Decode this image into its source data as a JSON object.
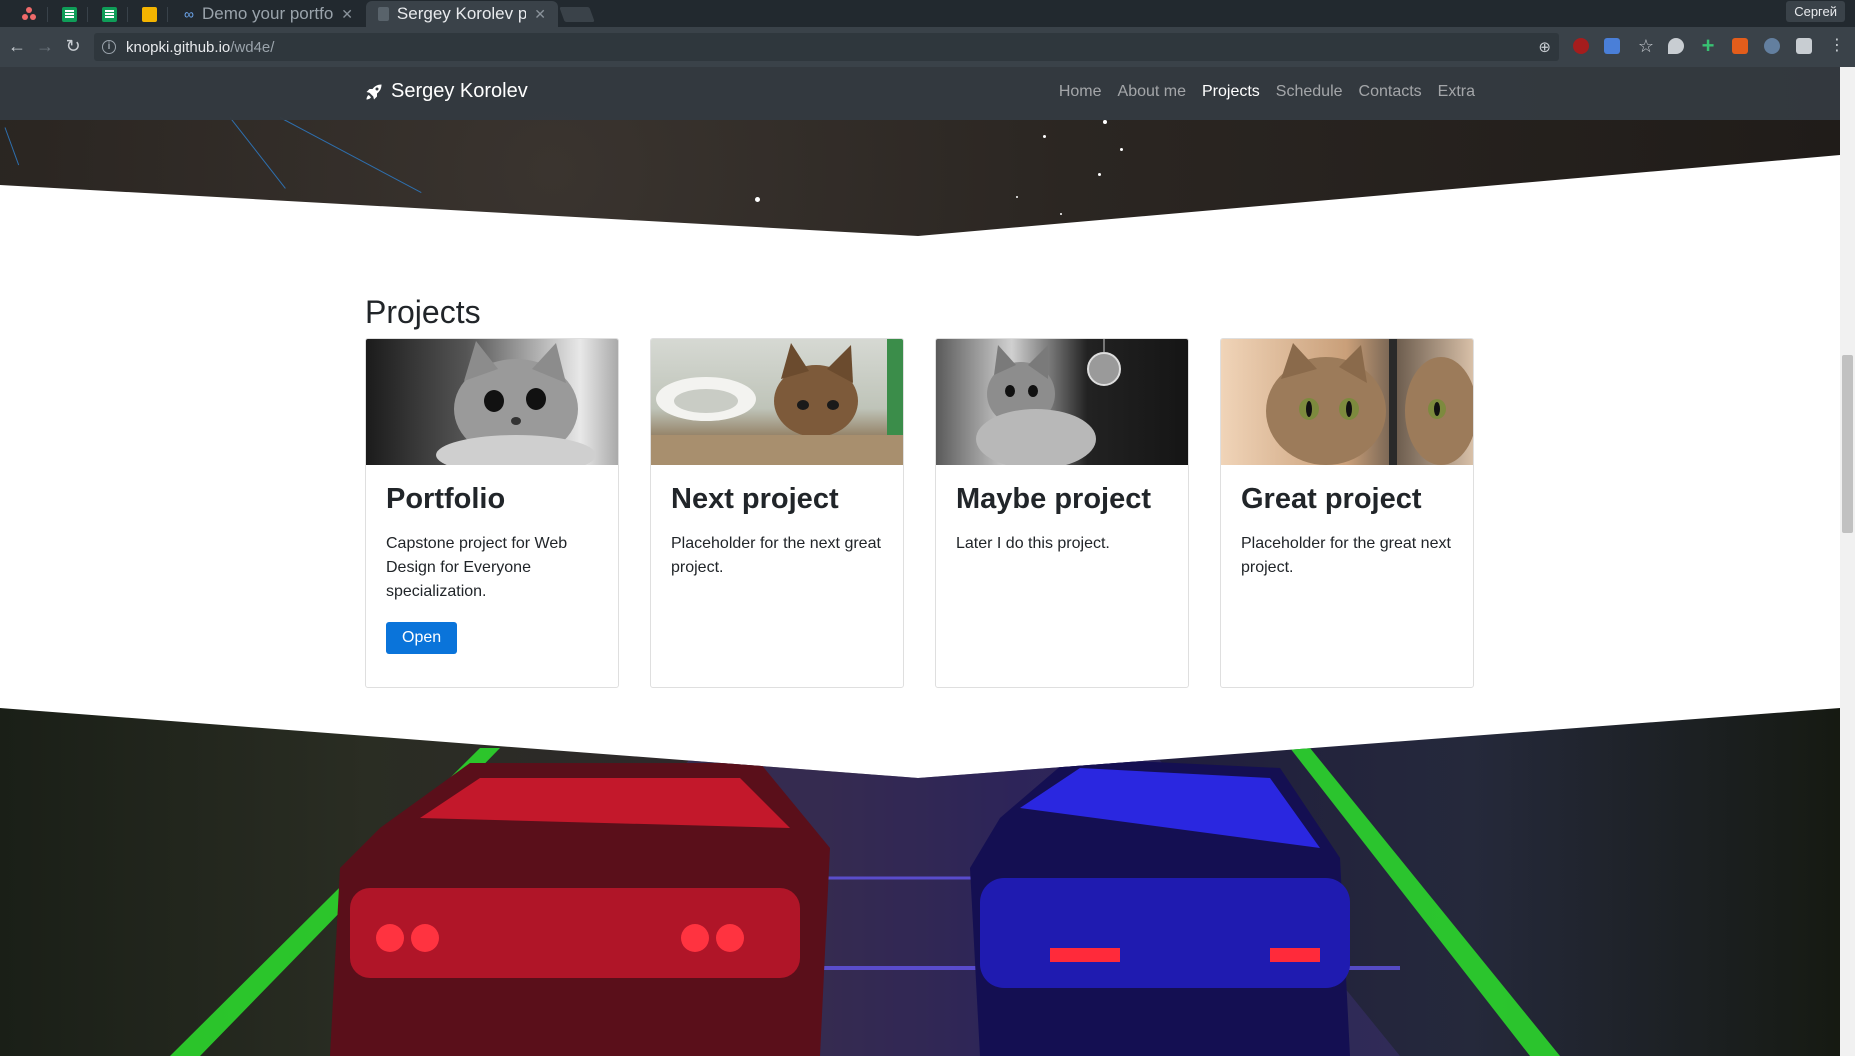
{
  "browser": {
    "tabs": [
      {
        "title": "Demo your portfo",
        "active": false
      },
      {
        "title": "Sergey Korolev p",
        "active": true
      }
    ],
    "profile_name": "Сергей",
    "url_host": "knopki.github.io",
    "url_path": "/wd4e/"
  },
  "navbar": {
    "brand": "Sergey Korolev",
    "links": [
      {
        "label": "Home",
        "active": false
      },
      {
        "label": "About me",
        "active": false
      },
      {
        "label": "Projects",
        "active": true
      },
      {
        "label": "Schedule",
        "active": false
      },
      {
        "label": "Contacts",
        "active": false
      },
      {
        "label": "Extra",
        "active": false
      }
    ]
  },
  "projects": {
    "title": "Projects",
    "cards": [
      {
        "title": "Portfolio",
        "text": "Capstone project for Web Design for Everyone specialization.",
        "button": "Open"
      },
      {
        "title": "Next project",
        "text": "Placeholder for the next great project."
      },
      {
        "title": "Maybe project",
        "text": "Later I do this project."
      },
      {
        "title": "Great project",
        "text": "Placeholder for the great next project."
      }
    ]
  },
  "colors": {
    "navbar_bg": "#343a40",
    "button_primary": "#0a74da",
    "browser_chrome": "#3a4249"
  }
}
